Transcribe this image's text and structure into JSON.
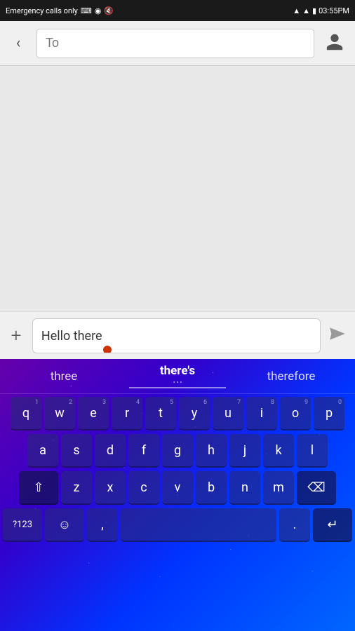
{
  "statusBar": {
    "leftText": "Emergency calls only",
    "time": "03:55PM",
    "icons": [
      "keyboard-icon",
      "android-icon",
      "mute-icon",
      "wifi-icon",
      "signal-icon",
      "battery-icon"
    ]
  },
  "topBar": {
    "backLabel": "‹",
    "toPlaceholder": "To",
    "contactIconLabel": "contact"
  },
  "composeBar": {
    "addLabel": "+",
    "messageText": "Hello there",
    "sendLabel": "➤"
  },
  "keyboard": {
    "suggestions": [
      {
        "text": "three",
        "active": false
      },
      {
        "text": "there's",
        "active": true,
        "dots": "..."
      },
      {
        "text": "therefore",
        "active": false
      }
    ],
    "rows": [
      [
        {
          "label": "q",
          "num": "1"
        },
        {
          "label": "w",
          "num": "2"
        },
        {
          "label": "e",
          "num": "3"
        },
        {
          "label": "r",
          "num": "4"
        },
        {
          "label": "t",
          "num": "5"
        },
        {
          "label": "y",
          "num": "6"
        },
        {
          "label": "u",
          "num": "7"
        },
        {
          "label": "i",
          "num": "8"
        },
        {
          "label": "o",
          "num": "9"
        },
        {
          "label": "p",
          "num": "0"
        }
      ],
      [
        {
          "label": "a"
        },
        {
          "label": "s"
        },
        {
          "label": "d"
        },
        {
          "label": "f"
        },
        {
          "label": "g"
        },
        {
          "label": "h"
        },
        {
          "label": "j"
        },
        {
          "label": "k"
        },
        {
          "label": "l"
        }
      ],
      [
        {
          "label": "⇧",
          "type": "shift"
        },
        {
          "label": "z"
        },
        {
          "label": "x"
        },
        {
          "label": "c"
        },
        {
          "label": "v"
        },
        {
          "label": "b"
        },
        {
          "label": "n"
        },
        {
          "label": "m"
        },
        {
          "label": "⌫",
          "type": "del"
        }
      ],
      [
        {
          "label": "?123",
          "type": "sym"
        },
        {
          "label": "☺",
          "type": "emoji"
        },
        {
          "label": ","
        },
        {
          "label": " ",
          "type": "space"
        },
        {
          "label": "."
        },
        {
          "label": "↵",
          "type": "enter"
        }
      ]
    ]
  }
}
